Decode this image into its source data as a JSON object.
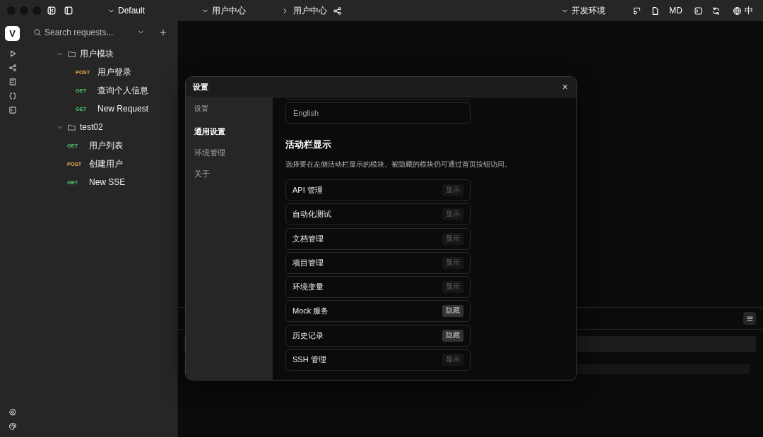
{
  "titlebar": {
    "workspace": "Default",
    "project": "用户中心",
    "breadcrumb": "用户中心",
    "environment": "开发环境",
    "format_button": "MD",
    "language": "中"
  },
  "sidebar": {
    "logo": "V",
    "search": {
      "placeholder": "Search requests..."
    },
    "tree": [
      {
        "kind": "folder",
        "name": "用户模块",
        "expanded": true,
        "children": [
          {
            "method": "POST",
            "color": "#e5a84a",
            "name": "用户登录"
          },
          {
            "method": "GET",
            "color": "#4cc56d",
            "name": "查询个人信息"
          },
          {
            "method": "GET",
            "color": "#4cc56d",
            "name": "New Request"
          }
        ]
      },
      {
        "kind": "folder",
        "name": "test02",
        "expanded": true
      },
      {
        "method": "GET",
        "color": "#4cc56d",
        "name": "用户列表"
      },
      {
        "method": "POST",
        "color": "#e5a84a",
        "name": "创建用户"
      },
      {
        "method": "GET",
        "color": "#4cc56d",
        "name": "New SSE"
      }
    ]
  },
  "settings_dialog": {
    "title": "设置",
    "close": "×",
    "nav": {
      "heading": "设置",
      "items": [
        {
          "label": "通用设置",
          "selected": true
        },
        {
          "label": "环境管理",
          "selected": false
        },
        {
          "label": "关于",
          "selected": false
        }
      ]
    },
    "language_field": {
      "value": "English"
    },
    "section": {
      "title": "活动栏显示",
      "description": "选择要在左侧活动栏显示的模块。被隐藏的模块仍可通过首页按钮访问。"
    },
    "modules": [
      {
        "name": "API 管理",
        "toggle": "显示",
        "hidden": false
      },
      {
        "name": "自动化测试",
        "toggle": "显示",
        "hidden": false
      },
      {
        "name": "文档管理",
        "toggle": "显示",
        "hidden": false
      },
      {
        "name": "项目管理",
        "toggle": "显示",
        "hidden": false
      },
      {
        "name": "环境变量",
        "toggle": "显示",
        "hidden": false
      },
      {
        "name": "Mock 服务",
        "toggle": "隐藏",
        "hidden": true
      },
      {
        "name": "历史记录",
        "toggle": "隐藏",
        "hidden": true
      },
      {
        "name": "SSH 管理",
        "toggle": "显示",
        "hidden": false
      }
    ]
  }
}
